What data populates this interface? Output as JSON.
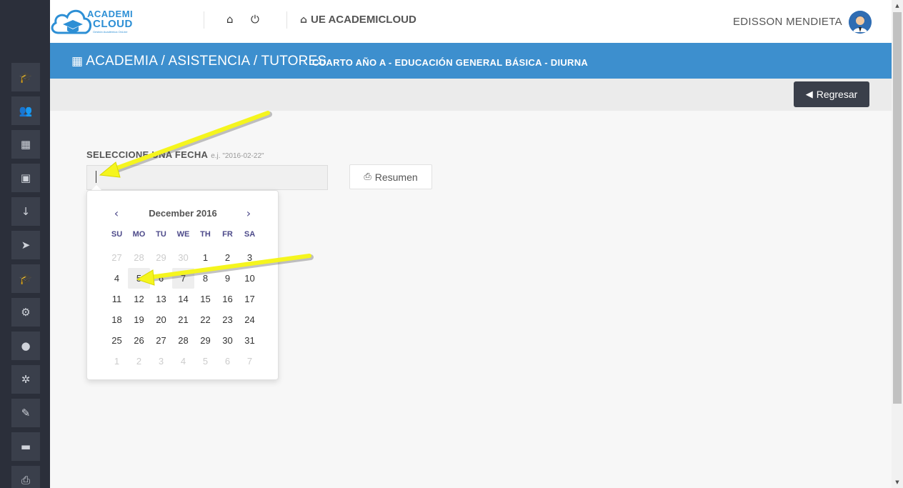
{
  "sidebar": {
    "icons": [
      "graduation-cap-icon",
      "users-icon",
      "calendar-icon",
      "money-icon",
      "sort-numeric-icon",
      "paper-plane-icon",
      "graduation-cap-icon",
      "bicycle-icon",
      "user-icon",
      "cogs-icon",
      "paint-brush-icon",
      "car-icon",
      "print-icon"
    ],
    "glyphs": [
      "🎓",
      "👥",
      "▦",
      "▣",
      "↓",
      "➤",
      "🎓",
      "⚙",
      "●",
      "✲",
      "✎",
      "▬",
      "⎙"
    ]
  },
  "header": {
    "logo_line1": "ACADEMI",
    "logo_line2": "CLOUD",
    "logo_tagline": "Gestión Académica OnLine",
    "app_title": "UE ACADEMICLOUD",
    "user_name": "EDISSON MENDIETA"
  },
  "breadcrumb": {
    "path": "ACADEMIA / ASISTENCIA / TUTORES",
    "separator": "›",
    "current": "CUARTO AÑO A - EDUCACIÓN GENERAL BÁSICA - DIURNA"
  },
  "toolbar": {
    "back_label": "Regresar"
  },
  "form": {
    "label": "SELECCIONE UNA FECHA",
    "hint": "e.j. \"2016-02-22\"",
    "date_value": "",
    "summary_label": "Resumen"
  },
  "datepicker": {
    "month_title": "December 2016",
    "weekdays": [
      "SU",
      "MO",
      "TU",
      "WE",
      "TH",
      "FR",
      "SA"
    ],
    "weeks": [
      [
        "27",
        "28",
        "29",
        "30",
        "1",
        "2",
        "3"
      ],
      [
        "4",
        "5",
        "6",
        "7",
        "8",
        "9",
        "10"
      ],
      [
        "11",
        "12",
        "13",
        "14",
        "15",
        "16",
        "17"
      ],
      [
        "18",
        "19",
        "20",
        "21",
        "22",
        "23",
        "24"
      ],
      [
        "25",
        "26",
        "27",
        "28",
        "29",
        "30",
        "31"
      ],
      [
        "1",
        "2",
        "3",
        "4",
        "5",
        "6",
        "7"
      ]
    ],
    "highlighted_days": [
      "5",
      "7"
    ]
  },
  "colors": {
    "sidebar_bg": "#2b2f3a",
    "breadcrumb_bg": "#3d8fce",
    "accent_text": "#4d4a8a",
    "annotation_arrow": "#f5f51e"
  }
}
